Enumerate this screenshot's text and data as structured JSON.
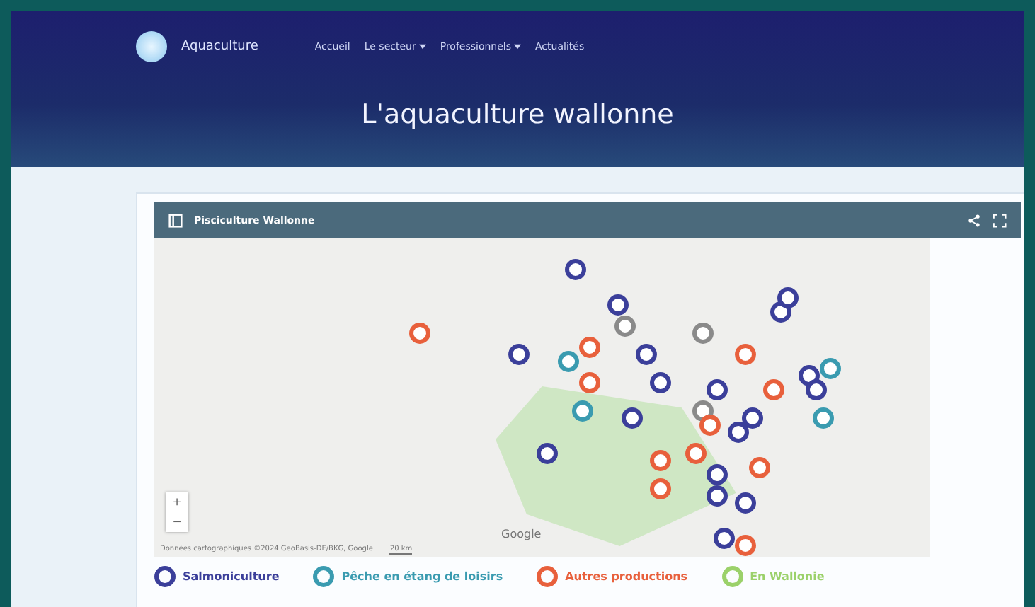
{
  "nav": {
    "brand": "Aquaculture",
    "links": [
      {
        "label": "Accueil",
        "has_menu": false
      },
      {
        "label": "Le secteur",
        "has_menu": true
      },
      {
        "label": "Professionnels",
        "has_menu": true
      },
      {
        "label": "Actualités",
        "has_menu": false
      }
    ]
  },
  "hero": {
    "title": "L'aquaculture wallonne"
  },
  "map": {
    "title": "Pisciculture Wallonne",
    "zoom_in": "+",
    "zoom_out": "−",
    "attribution": "Données cartographiques ©2024 GeoBasis-DE/BKG, Google",
    "scale": "20 km",
    "logo": "Google",
    "markers": [
      {
        "color": "#3b3f9a"
      },
      {
        "color": "#e8603c"
      },
      {
        "color": "#3b3f9a"
      },
      {
        "color": "#8a8a8a"
      },
      {
        "color": "#3b3f9a"
      },
      {
        "color": "#e8603c"
      },
      {
        "color": "#3b3f9a"
      },
      {
        "color": "#3a9bb0"
      },
      {
        "color": "#e8603c"
      },
      {
        "color": "#3b3f9a"
      },
      {
        "color": "#8a8a8a"
      },
      {
        "color": "#e8603c"
      },
      {
        "color": "#3b3f9a"
      },
      {
        "color": "#3a9bb0"
      },
      {
        "color": "#e8603c"
      },
      {
        "color": "#3b3f9a"
      },
      {
        "color": "#8a8a8a"
      },
      {
        "color": "#3b3f9a"
      },
      {
        "color": "#e8603c"
      },
      {
        "color": "#3b3f9a"
      },
      {
        "color": "#3a9bb0"
      },
      {
        "color": "#3b3f9a"
      },
      {
        "color": "#e8603c"
      },
      {
        "color": "#3b3f9a"
      },
      {
        "color": "#3b3f9a"
      },
      {
        "color": "#e8603c"
      },
      {
        "color": "#3b3f9a"
      },
      {
        "color": "#e8603c"
      },
      {
        "color": "#3b3f9a"
      },
      {
        "color": "#3b3f9a"
      },
      {
        "color": "#e8603c"
      },
      {
        "color": "#3b3f9a"
      },
      {
        "color": "#e8603c"
      },
      {
        "color": "#3b3f9a"
      },
      {
        "color": "#3a9bb0"
      },
      {
        "color": "#3b3f9a"
      }
    ]
  },
  "legend": [
    {
      "label": "Salmoniculture",
      "color": "#3b3f9a"
    },
    {
      "label": "Pêche en étang de loisirs",
      "color": "#3a9bb0"
    },
    {
      "label": "Autres productions",
      "color": "#e8603c"
    },
    {
      "label": "En Wallonie",
      "color": "#9bd16a"
    }
  ]
}
